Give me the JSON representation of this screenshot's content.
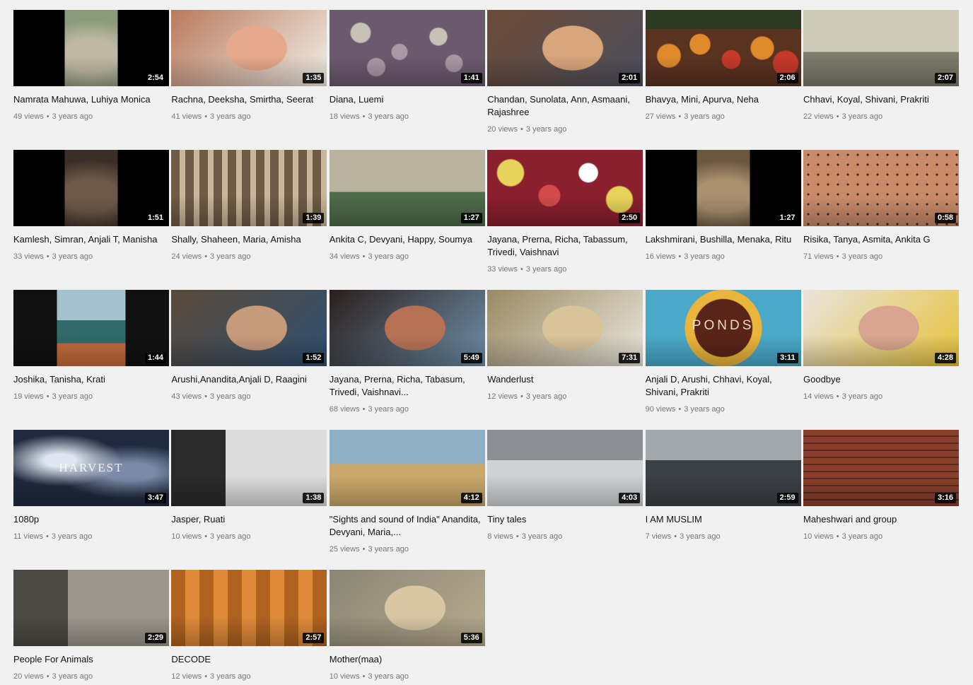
{
  "separator": "•",
  "videos": [
    {
      "title": "Namrata Mahuwa, Luhiya Monica",
      "views": "49 views",
      "age": "3 years ago",
      "duration": "2:54",
      "thumb": "pillar",
      "colors": [
        "#8b9a7a",
        "#c0b9a4",
        "#3f5f8f"
      ]
    },
    {
      "title": "Rachna, Deeksha, Smirtha, Seerat",
      "views": "41 views",
      "age": "3 years ago",
      "duration": "1:35",
      "thumb": "face",
      "colors": [
        "#b97a5d",
        "#e6a98e",
        "#f2efe8"
      ]
    },
    {
      "title": "Diana, Luemi",
      "views": "18 views",
      "age": "3 years ago",
      "duration": "1:41",
      "thumb": "coins",
      "colors": [
        "#6b5a6e",
        "#a899a7",
        "#c8c1b6"
      ]
    },
    {
      "title": "Chandan, Sunolata, Ann, Asmaani, Rajashree",
      "views": "20 views",
      "age": "3 years ago",
      "duration": "2:01",
      "thumb": "face",
      "colors": [
        "#6d4b37",
        "#d8a57c",
        "#4c4f5e"
      ]
    },
    {
      "title": "Bhavya, Mini, Apurva, Neha",
      "views": "27 views",
      "age": "3 years ago",
      "duration": "2:06",
      "thumb": "fruit",
      "colors": [
        "#5a3220",
        "#e08a2c",
        "#c73a2a"
      ]
    },
    {
      "title": "Chhavi, Koyal, Shivani, Prakriti",
      "views": "22 views",
      "age": "3 years ago",
      "duration": "2:07",
      "thumb": "street",
      "colors": [
        "#7c7b6c",
        "#cfc9b7",
        "#d9c520"
      ]
    },
    {
      "title": "Kamlesh, Simran, Anjali T, Manisha",
      "views": "33 views",
      "age": "3 years ago",
      "duration": "1:51",
      "thumb": "pillar",
      "colors": [
        "#3a2f28",
        "#6f5a4a",
        "#1b1b1b"
      ]
    },
    {
      "title": "Shally, Shaheen, Maria, Amisha",
      "views": "24 views",
      "age": "3 years ago",
      "duration": "1:39",
      "thumb": "shop",
      "colors": [
        "#6e5a45",
        "#c9b59a",
        "#8fa2c2"
      ]
    },
    {
      "title": "Ankita C, Devyani, Happy, Soumya",
      "views": "34 views",
      "age": "3 years ago",
      "duration": "1:27",
      "thumb": "street",
      "colors": [
        "#4f6b4a",
        "#b9b29f",
        "#c0392b"
      ]
    },
    {
      "title": "Jayana, Prerna, Richa, Tabassum, Trivedi, Vaishnavi",
      "views": "33 views",
      "age": "3 years ago",
      "duration": "2:50",
      "thumb": "badges",
      "colors": [
        "#8a1f2e",
        "#d34a4a",
        "#e8d35a"
      ]
    },
    {
      "title": "Lakshmirani, Bushilla, Menaka, Ritu",
      "views": "16 views",
      "age": "3 years ago",
      "duration": "1:27",
      "thumb": "pillar",
      "colors": [
        "#6b5640",
        "#a9916f",
        "#111111"
      ]
    },
    {
      "title": "Risika, Tanya, Asmita, Ankita G",
      "views": "71 views",
      "age": "3 years ago",
      "duration": "0:58",
      "thumb": "pattern",
      "colors": [
        "#c98a6a",
        "#3a2a22",
        "#6b8f4e"
      ]
    },
    {
      "title": "Joshika, Tanisha, Krati",
      "views": "19 views",
      "age": "3 years ago",
      "duration": "1:44",
      "thumb": "court",
      "colors": [
        "#2f6b6a",
        "#a5c3cf",
        "#c46b3c"
      ]
    },
    {
      "title": "Arushi,Anandita,Anjali D, Raagini",
      "views": "43 views",
      "age": "3 years ago",
      "duration": "1:52",
      "thumb": "face",
      "colors": [
        "#5a4a3a",
        "#c89a7c",
        "#2f4f6f"
      ]
    },
    {
      "title": "Jayana, Prerna, Richa, Tabasum, Trivedi, Vaishnavi...",
      "views": "68 views",
      "age": "3 years ago",
      "duration": "5:49",
      "thumb": "face",
      "colors": [
        "#2a1f1c",
        "#b77256",
        "#6f8fa8"
      ]
    },
    {
      "title": "Wanderlust",
      "views": "12 views",
      "age": "3 years ago",
      "duration": "7:31",
      "thumb": "face",
      "colors": [
        "#9a8a64",
        "#d8c39a",
        "#e9e6dc"
      ]
    },
    {
      "title": "Anjali D, Arushi, Chhavi, Koyal, Shivani, Prakriti",
      "views": "90 views",
      "age": "3 years ago",
      "duration": "3:11",
      "thumb": "bowl",
      "colors": [
        "#4aa8c8",
        "#e9b53a",
        "#5a2418"
      ]
    },
    {
      "title": "Goodbye",
      "views": "14 views",
      "age": "3 years ago",
      "duration": "4:28",
      "thumb": "face",
      "colors": [
        "#e9e4dd",
        "#d9a58e",
        "#e6c23a"
      ]
    },
    {
      "title": "1080p",
      "views": "11 views",
      "age": "3 years ago",
      "duration": "3:47",
      "thumb": "sky",
      "colors": [
        "#1f2a3f",
        "#7b8aa8",
        "#dfe6ef"
      ]
    },
    {
      "title": "Jasper, Ruati",
      "views": "10 views",
      "age": "3 years ago",
      "duration": "1:38",
      "thumb": "room",
      "colors": [
        "#2a2a2a",
        "#dcdcdc",
        "#c46aa1"
      ]
    },
    {
      "title": "\"Sights and sound of India\" Anandita, Devyani, Maria,...",
      "views": "25 views",
      "age": "3 years ago",
      "duration": "4:12",
      "thumb": "field",
      "colors": [
        "#8fb0c4",
        "#c93a32",
        "#d98ab0"
      ]
    },
    {
      "title": "Tiny tales",
      "views": "8 views",
      "age": "3 years ago",
      "duration": "4:03",
      "thumb": "office",
      "colors": [
        "#cfd2d4",
        "#8c8f93",
        "#d4b3b8"
      ]
    },
    {
      "title": "I AM MUSLIM",
      "views": "7 views",
      "age": "3 years ago",
      "duration": "2:59",
      "thumb": "office",
      "colors": [
        "#3b3f46",
        "#a3a7ae",
        "#1a1a1a"
      ]
    },
    {
      "title": "Maheshwari and group",
      "views": "10 views",
      "age": "3 years ago",
      "duration": "3:16",
      "thumb": "brick",
      "colors": [
        "#8a3f2c",
        "#b55a3f",
        "#3c8aa8"
      ]
    },
    {
      "title": "People For Animals",
      "views": "20 views",
      "age": "3 years ago",
      "duration": "2:29",
      "thumb": "room",
      "colors": [
        "#4c4a44",
        "#9b968c",
        "#cfe3d9"
      ]
    },
    {
      "title": "DECODE",
      "views": "12 views",
      "age": "3 years ago",
      "duration": "2:57",
      "thumb": "wood",
      "colors": [
        "#b0621f",
        "#e08a3a",
        "#d3406a"
      ]
    },
    {
      "title": "Mother(maa)",
      "views": "10 views",
      "age": "3 years ago",
      "duration": "5:36",
      "thumb": "face",
      "colors": [
        "#8a8675",
        "#d9c7a4",
        "#b7aa8f"
      ]
    }
  ],
  "watermarks": {
    "1080p": "HARVEST",
    "Anjali D, Arushi, Chhavi, Koyal, Shivani, Prakriti": "PONDS"
  }
}
